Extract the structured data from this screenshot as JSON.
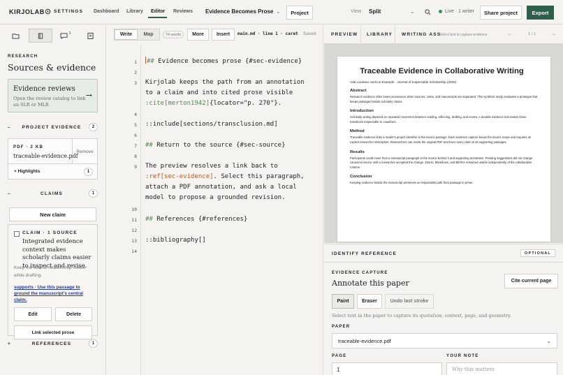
{
  "topbar": {
    "brand": "KIRJOLAB",
    "settings": "SETTINGS",
    "nav": [
      "Dashboard",
      "Library",
      "Editor",
      "Reviews"
    ],
    "doc_title": "Evidence Becomes Prose",
    "project": "Project",
    "view_label": "View",
    "view_value": "Split",
    "live": "Live · 1 writer",
    "share": "Share project",
    "export": "Export",
    "accent": "#2f5f4a"
  },
  "sidebar": {
    "icons": [
      "folder-icon",
      "book-icon",
      "comment-icon",
      "clipboard-icon"
    ],
    "comment_badge": "1",
    "research_label": "RESEARCH",
    "title": "Sources & evidence",
    "reviews_card": {
      "title": "Evidence reviews",
      "text": "Open the review catalog to link an SLR or MLR"
    },
    "project_evidence": {
      "label": "PROJECT EVIDENCE",
      "count": "2"
    },
    "pdf": {
      "meta": "PDF · 2 KB",
      "name": "traceable-evidence.pdf",
      "remove": "Remove"
    },
    "highlights": {
      "label": "+ Highlights",
      "count": "1"
    },
    "claims": {
      "label": "CLAIMS",
      "count": "1"
    },
    "new_claim": "New claim",
    "claim": {
      "meta": "CLAIM · 1 SOURCE",
      "text": "Integrated evidence context makes scholarly claims easier to inspect and revise.",
      "note": "Keep the source relationship visible while drafting.",
      "supports": "supports · Use this passage to ground the manuscript's central claim.",
      "edit": "Edit",
      "delete": "Delete",
      "link": "Link selected prose"
    },
    "references": {
      "label": "REFERENCES",
      "count": "1"
    }
  },
  "editor": {
    "mode_write": "Write",
    "mode_map": "Map",
    "words": "74 words",
    "more": "More",
    "insert": "Insert",
    "fileinfo": "main.md · line 1 · caret",
    "saved": "Saved",
    "line_numbers": [
      "1",
      "2",
      "3",
      "4",
      "5",
      "6",
      "7",
      "8",
      "9",
      "10",
      "11",
      "12",
      "13",
      "14"
    ],
    "lines": {
      "l1_mark": "##",
      "l1_text": " Evidence becomes prose {#sec-evidence}",
      "l3_text": "Kirjolab keeps the path from an annotation to a claim and into cited prose visible ",
      "l3_cite": ":cite[merton1942]",
      "l3_tail": "{locator=\"p. 270\"}.",
      "l5": "::include[sections/transclusion.md]",
      "l7_mark": "##",
      "l7_text": " Return to the source {#sec-source}",
      "l9_text": "The preview resolves a link back to ",
      "l9_ref": ":ref[sec-evidence]",
      "l9_tail": ". Select this paragraph, attach a PDF annotation, and ask a local model to propose a grounded revision.",
      "l11_mark": "##",
      "l11_text": " References {#references}",
      "l13": "::bibliography[]"
    }
  },
  "rightpane": {
    "tabs": [
      "PREVIEW",
      "LIBRARY",
      "WRITING ASS"
    ],
    "capture_hint": "Select text to capture evidence",
    "prev": "←",
    "pager": "1 / 1",
    "next": "→",
    "paper": {
      "title": "Traceable Evidence in Collaborative Writing",
      "authors": "Ada Lovelace and Lin Example · Journal of Inspectable Scholarship (2026)",
      "sections": [
        {
          "h": "Abstract",
          "p": "Research evidence often loses provenance when sources, notes, and manuscripts are separated. This synthetic study evaluates a prototype that keeps passages beside scholarly claims."
        },
        {
          "h": "Introduction",
          "p": "Scholarly writing depends on repeated movement between reading, reflecting, drafting, and review. A durable evidence trail makes those transitions inspectable to coauthors."
        },
        {
          "h": "Method",
          "p": "Traceable evidence links a reader's project identifier to the source passage. Each evidence capture keeps the source scope and requires an explicit researcher description. Researchers can revisit the original PDF and trace every claim to its supporting passages."
        },
        {
          "h": "Results",
          "p": "Participants could move from a manuscript paragraph to the source behind it and supporting annotation. Pending suggestions did not change canonical source until a researcher accepted the change. Zotero, Markdown, and BibTeX remained usable independently of the collaborative runtime."
        },
        {
          "h": "Conclusion",
          "p": "Keeping evidence beside the manuscript preserves an inspectable path from passage to prose."
        }
      ]
    },
    "identify": "IDENTIFY REFERENCE",
    "optional": "OPTIONAL",
    "evidence_capture": "EVIDENCE CAPTURE",
    "annotate": "Annotate this paper",
    "cite_page": "Cite current page",
    "tools": [
      "Paint",
      "Eraser",
      "Undo last stroke"
    ],
    "select_hint": "Select text in the paper to capture its quotation, context, page, and geometry.",
    "paper_label": "PAPER",
    "paper_value": "traceable-evidence.pdf",
    "page_label": "PAGE",
    "page_value": "1",
    "note_label": "YOUR NOTE",
    "note_placeholder": "Why this matters"
  }
}
